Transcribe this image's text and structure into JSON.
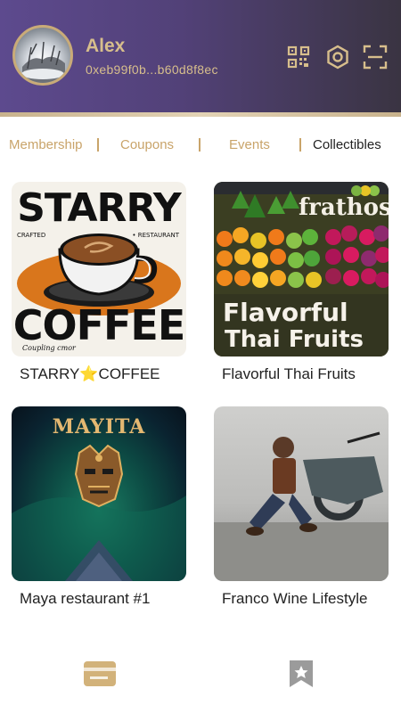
{
  "header": {
    "user_name": "Alex",
    "wallet_address": "0xeb99f0b...b60d8f8ec",
    "icons": [
      "qr-code-icon",
      "settings-icon",
      "scan-icon"
    ]
  },
  "tabs": [
    {
      "label": "Membership",
      "active": false
    },
    {
      "label": "Coupons",
      "active": false
    },
    {
      "label": "Events",
      "active": false
    },
    {
      "label": "Collectibles",
      "active": true
    }
  ],
  "collectibles": [
    {
      "title": "STARRY⭐COFFEE",
      "image": {
        "line1": "STARRY",
        "line2": "COFFEE",
        "sub_left": "CRAFTED",
        "sub_right": "• RESTAURANT",
        "script": "Coupling cmor"
      }
    },
    {
      "title": "Flavorful Thai Fruits",
      "image": {
        "top": "frathos",
        "line1": "Flavorful",
        "line2": "Thai Fruits"
      }
    },
    {
      "title": "Maya restaurant #1",
      "image": {
        "line1": "MAYITA"
      }
    },
    {
      "title": "Franco Wine Lifestyle",
      "image": {}
    }
  ],
  "bottom_nav": {
    "items": [
      {
        "name": "wallet-icon",
        "active": true
      },
      {
        "name": "bookmark-star-icon",
        "active": false
      }
    ]
  },
  "colors": {
    "accent_gold": "#c9a46a",
    "header_purple": "#5d4a8e"
  }
}
